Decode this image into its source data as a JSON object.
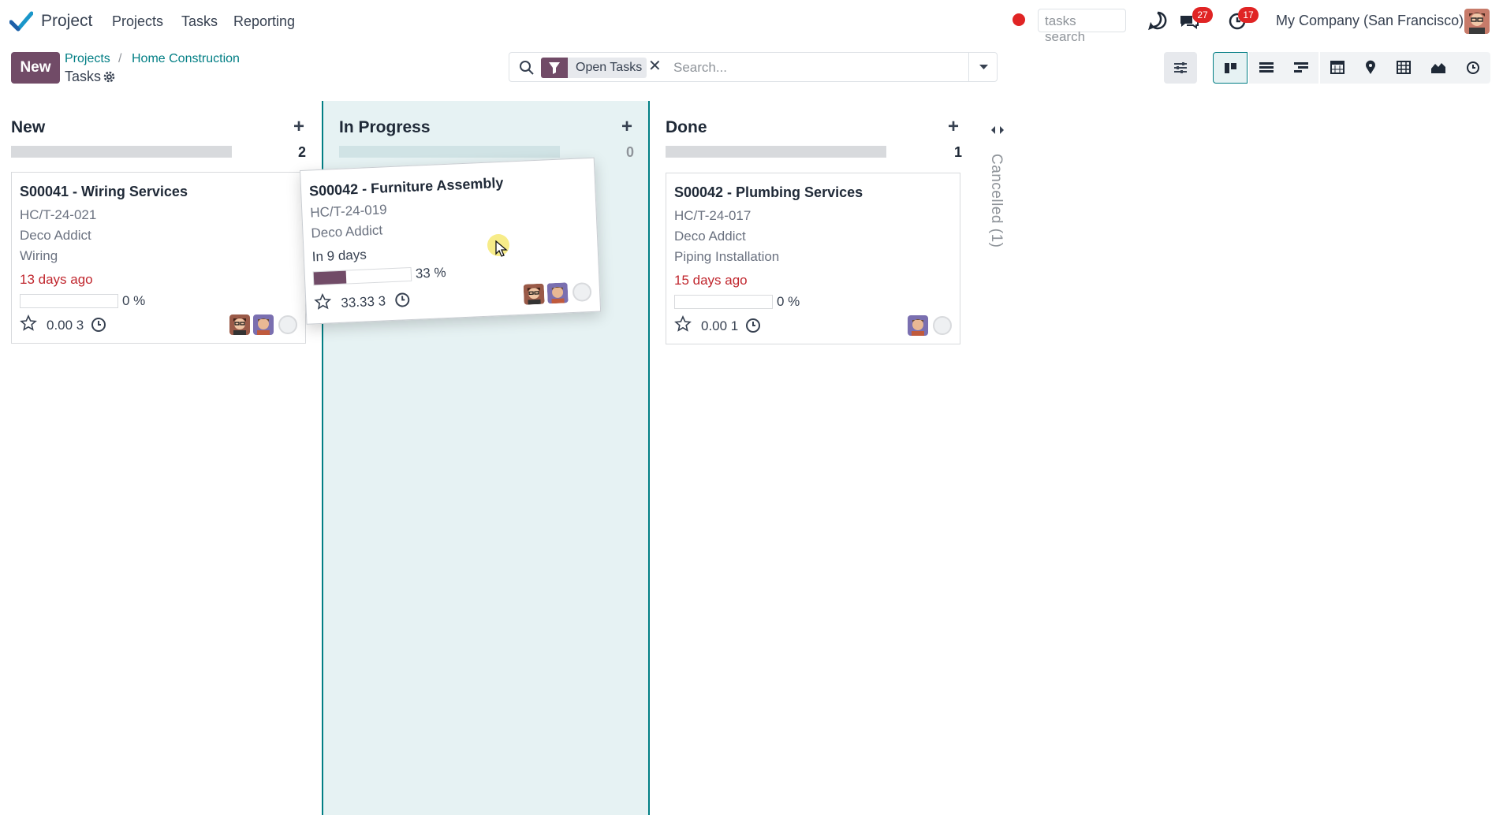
{
  "navbar": {
    "app_name": "Project",
    "menu": [
      "Projects",
      "Tasks",
      "Reporting"
    ],
    "search_placeholder": "tasks search",
    "messages_badge": "27",
    "activities_badge": "17",
    "company": "My Company (San Francisco)",
    "icons": [
      "app-logo-icon",
      "record-dot-icon",
      "voip-icon",
      "chat-icon",
      "activity-clock-icon",
      "user-avatar"
    ]
  },
  "control_panel": {
    "new_label": "New",
    "breadcrumb": [
      "Projects",
      "Home Construction"
    ],
    "breadcrumb_sep": "/",
    "current": "Tasks",
    "facet": "Open Tasks",
    "search_placeholder": "Search...",
    "views": [
      "kanban",
      "list",
      "gantt",
      "calendar",
      "map",
      "pivot",
      "graph",
      "activity"
    ],
    "active_view": "kanban"
  },
  "columns": [
    {
      "title": "New",
      "count": "2"
    },
    {
      "title": "In Progress",
      "count": "0"
    },
    {
      "title": "Done",
      "count": "1"
    }
  ],
  "cancelled_label": "Cancelled (1)",
  "cards": {
    "wiring": {
      "title": "S00041 - Wiring Services",
      "ref": "HC/T-24-021",
      "customer": "Deco Addict",
      "tag": "Wiring",
      "date": "13 days ago",
      "progress": 0,
      "progress_label": "0 %",
      "hours": "0.00 3"
    },
    "furniture": {
      "title": "S00042 - Furniture Assembly",
      "ref": "HC/T-24-019",
      "customer": "Deco Addict",
      "date": "In 9 days",
      "progress": 33,
      "progress_label": "33 %",
      "hours": "33.33 3"
    },
    "plumbing": {
      "title": "S00042 - Plumbing Services",
      "ref": "HC/T-24-017",
      "customer": "Deco Addict",
      "tag": "Piping Installation",
      "date": "15 days ago",
      "progress": 0,
      "progress_label": "0 %",
      "hours": "0.00 1"
    }
  },
  "colors": {
    "brand": "#714b67",
    "link": "#017e84",
    "overdue": "#c0262d",
    "drop_zone": "#e6f2f3"
  }
}
